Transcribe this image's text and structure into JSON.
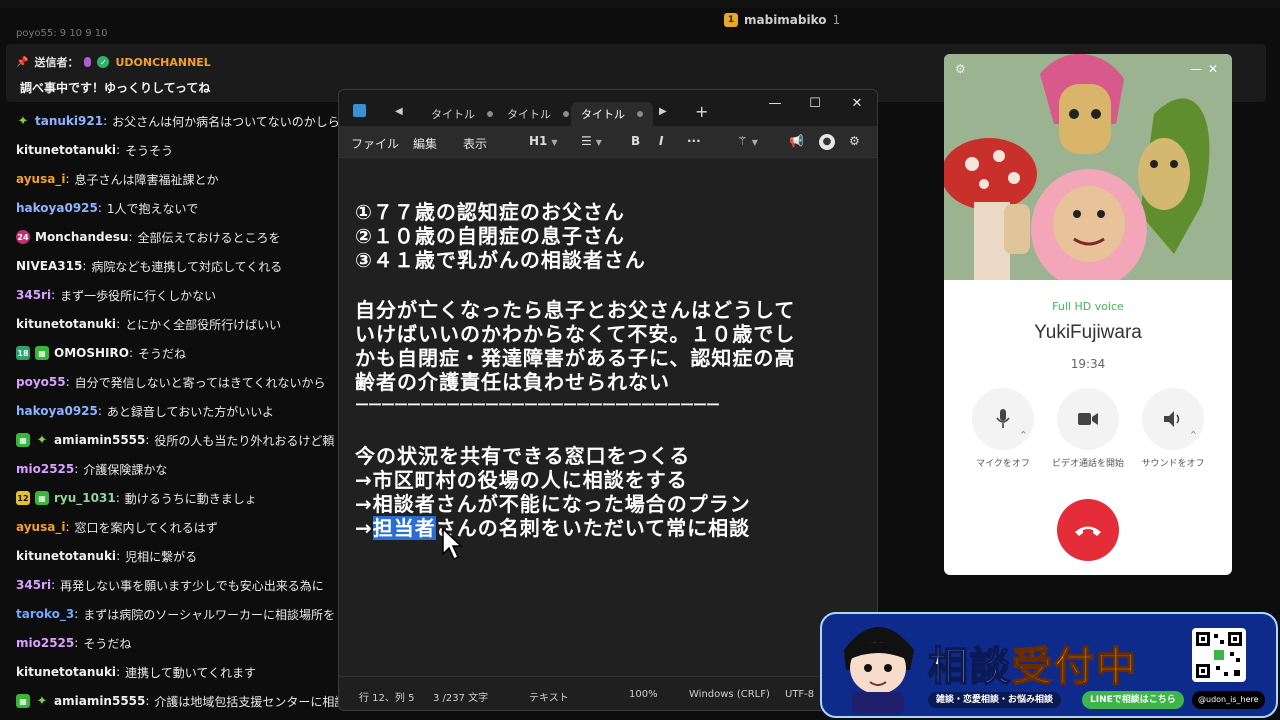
{
  "stream": {
    "viewer_name": "mabimabiko",
    "viewer_count": "1",
    "chat_cut_text": "poyo55: 9 10 9 10"
  },
  "pinned": {
    "label": "送信者：",
    "channel": "UDONCHANNEL",
    "message": "調べ事中です！ゆっくりしてってね",
    "channel_color": "#f3a12b"
  },
  "chat": [
    {
      "user": "tanuki921",
      "text": "お父さんは何か病名はついてないのかしら",
      "color": "#8fb4ff",
      "badges": [
        "sparkle"
      ]
    },
    {
      "user": "kitunetotanuki",
      "text": "そうそう",
      "color": "#f0f0f0",
      "badges": []
    },
    {
      "user": "ayusa_i",
      "text": "息子さんは障害福祉課とか",
      "color": "#f3a12b",
      "badges": []
    },
    {
      "user": "hakoya0925",
      "text": "1人で抱えないで",
      "color": "#8fb4ff",
      "badges": []
    },
    {
      "user": "Monchandesu",
      "text": "全部伝えておけるところを",
      "color": "#f0f0f0",
      "badges": [
        "pink"
      ]
    },
    {
      "user": "NIVEA315",
      "text": "病院なども連携して対応してくれる",
      "color": "#f0f0f0",
      "badges": []
    },
    {
      "user": "345ri",
      "text": "まず一歩役所に行くしかない",
      "color": "#d9a0ff",
      "badges": []
    },
    {
      "user": "kitunetotanuki",
      "text": "とにかく全部役所行けばいい",
      "color": "#f0f0f0",
      "badges": []
    },
    {
      "user": "OMOSHIRO",
      "text": "そうだね",
      "color": "#f0f0f0",
      "badges": [
        "sub",
        "gift"
      ]
    },
    {
      "user": "poyo55",
      "text": "自分で発信しないと寄ってはきてくれないから",
      "color": "#d9a0ff",
      "badges": []
    },
    {
      "user": "hakoya0925",
      "text": "あと録音しておいた方がいいよ",
      "color": "#8fb4ff",
      "badges": []
    },
    {
      "user": "amiamin5555",
      "text": "役所の人も当たり外れおるけど頼",
      "color": "#f0f0f0",
      "badges": [
        "gift",
        "sparkle"
      ]
    },
    {
      "user": "mio2525",
      "text": "介護保険課かな",
      "color": "#d9a0ff",
      "badges": []
    },
    {
      "user": "ryu_1031",
      "text": "動けるうちに動きましょ",
      "color": "#8fd49a",
      "badges": [
        "yellow",
        "gift"
      ]
    },
    {
      "user": "ayusa_i",
      "text": "窓口を案内してくれるはず",
      "color": "#f3a12b",
      "badges": []
    },
    {
      "user": "kitunetotanuki",
      "text": "児相に繋がる",
      "color": "#f0f0f0",
      "badges": []
    },
    {
      "user": "345ri",
      "text": "再発しない事を願います少しでも安心出来る為に",
      "color": "#d9a0ff",
      "badges": []
    },
    {
      "user": "taroko_3",
      "text": "まずは病院のソーシャルワーカーに相談場所を",
      "color": "#6fa8ff",
      "badges": []
    },
    {
      "user": "mio2525",
      "text": "そうだね",
      "color": "#d9a0ff",
      "badges": []
    },
    {
      "user": "kitunetotanuki",
      "text": "連携して動いてくれます",
      "color": "#f0f0f0",
      "badges": []
    },
    {
      "user": "amiamin5555",
      "text": "介護は地域包括支援センターに相談",
      "color": "#f0f0f0",
      "badges": [
        "gift",
        "sparkle"
      ]
    }
  ],
  "editor": {
    "tabs": [
      "タイトル",
      "タイトル",
      "タイトル"
    ],
    "active_tab": 2,
    "menu": [
      "ファイル",
      "編集",
      "表示"
    ],
    "heading_select": "H1",
    "lines": [
      "①７７歳の認知症のお父さん",
      "②１０歳の自閉症の息子さん",
      "③４１歳で乳がんの相談者さん",
      "",
      "自分が亡くなったら息子とお父さんはどうして",
      "いけばいいのかわからなくて不安。１０歳でし",
      "かも自閉症・発達障害がある子に、認知症の高",
      "齢者の介護責任は負わせられない",
      "ーーーーーーーーーーーーーーーーーーーーーーーーーーーー",
      "",
      "今の状況を共有できる窓口をつくる",
      "→市区町村の役場の人に相談をする",
      "→相談者さんが不能になった場合のプラン"
    ],
    "last_line_prefix": "→",
    "last_line_selected": "担当者",
    "last_line_rest": "さんの名刺をいただいて常に相談",
    "status": {
      "position": "行 12、列 5",
      "chars": "3 /237 文字",
      "format": "テキスト",
      "zoom": "100%",
      "line_ending": "Windows (CRLF)",
      "encoding": "UTF-8"
    }
  },
  "call": {
    "quality": "Full HD voice",
    "caller": "YukiFujiwara",
    "time": "19:34",
    "mic_label": "マイクをオフ",
    "video_label": "ビデオ通話を開始",
    "sound_label": "サウンドをオフ",
    "accent": "#e52d3a"
  },
  "banner": {
    "title_1": "相談",
    "title_2": "受付中",
    "sub": "雑談・恋愛相談・お悩み相談",
    "line": "LINEで相談はこちら",
    "x_handle": "@udon_is_here"
  }
}
